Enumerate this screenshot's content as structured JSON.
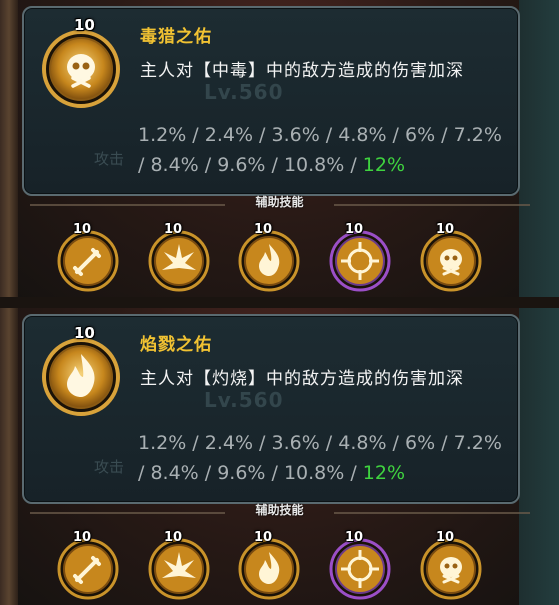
{
  "panels": [
    {
      "skill_level": "10",
      "title": "毒猎之佑",
      "description": "主人对【中毒】中的敌方造成的伤害加深",
      "values_line1": "1.2% / 2.4% / 3.6% / 4.8% / 6% / 7.2%",
      "values_line2": "/ 8.4% / 9.6% / 10.8% / ",
      "current_value": "12%",
      "icon": "poison-skull-icon",
      "section_label": "辅助技能",
      "skills": [
        {
          "level": "10",
          "icon": "sword-icon",
          "ring": "#c9932a"
        },
        {
          "level": "10",
          "icon": "burst-icon",
          "ring": "#c9932a"
        },
        {
          "level": "10",
          "icon": "flame-icon",
          "ring": "#c9932a"
        },
        {
          "level": "10",
          "icon": "crosshair-icon",
          "ring": "#9b4fc7"
        },
        {
          "level": "10",
          "icon": "poison-skull-icon",
          "ring": "#c9932a"
        }
      ],
      "bg_faded_text": "Lv.560",
      "bg_faded_text2": "攻击"
    },
    {
      "skill_level": "10",
      "title": "焰戮之佑",
      "description": "主人对【灼烧】中的敌方造成的伤害加深",
      "values_line1": "1.2% / 2.4% / 3.6% / 4.8% / 6% / 7.2%",
      "values_line2": "/ 8.4% / 9.6% / 10.8% / ",
      "current_value": "12%",
      "icon": "flame-icon",
      "section_label": "辅助技能",
      "skills": [
        {
          "level": "10",
          "icon": "sword-icon",
          "ring": "#c9932a"
        },
        {
          "level": "10",
          "icon": "burst-icon",
          "ring": "#c9932a"
        },
        {
          "level": "10",
          "icon": "flame-icon",
          "ring": "#c9932a"
        },
        {
          "level": "10",
          "icon": "crosshair-icon",
          "ring": "#9b4fc7"
        },
        {
          "level": "10",
          "icon": "poison-skull-icon",
          "ring": "#c9932a"
        }
      ],
      "bg_faded_text": "Lv.560",
      "bg_faded_text2": "攻击"
    }
  ],
  "colors": {
    "title": "#f1c232",
    "highlight": "#3fd33f",
    "ring_gold": "#c9932a",
    "ring_purple": "#9b4fc7"
  }
}
